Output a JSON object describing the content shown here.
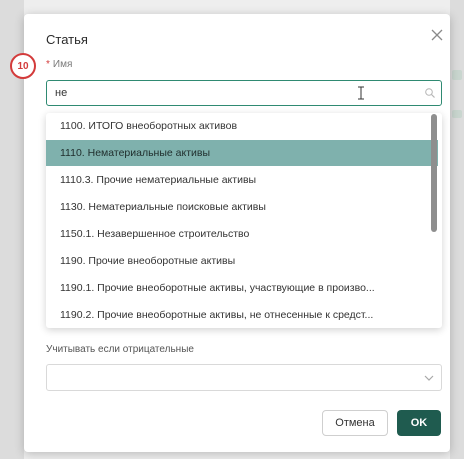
{
  "dialog": {
    "title": "Статья",
    "step_number": "10",
    "name_field": {
      "required_mark": "*",
      "label": "Имя",
      "value": "не"
    },
    "dropdown_options": [
      "1100. ИТОГО внеоборотных активов",
      "1110. Нематериальные активы",
      "1110.3. Прочие нематериальные активы",
      "1130. Нематериальные поисковые активы",
      "1150.1. Незавершенное строительство",
      "1190. Прочие внеоборотные активы",
      "1190.1. Прочие внеоборотные активы, участвующие в произво...",
      "1190.2. Прочие внеоборотные активы, не отнесенные к средст..."
    ],
    "selected_option_index": 1,
    "negative_field": {
      "label": "Учитывать если отрицательные",
      "value": ""
    },
    "buttons": {
      "cancel": "Отмена",
      "ok": "OK"
    }
  },
  "colors": {
    "accent": "#1f5b4f",
    "input_focus_border": "#2f8a72",
    "selected_row": "#7fb1ad",
    "step_badge": "#d33b3b"
  },
  "icons": [
    "close-icon",
    "search-icon",
    "text-cursor-icon",
    "chevron-down-icon"
  ]
}
